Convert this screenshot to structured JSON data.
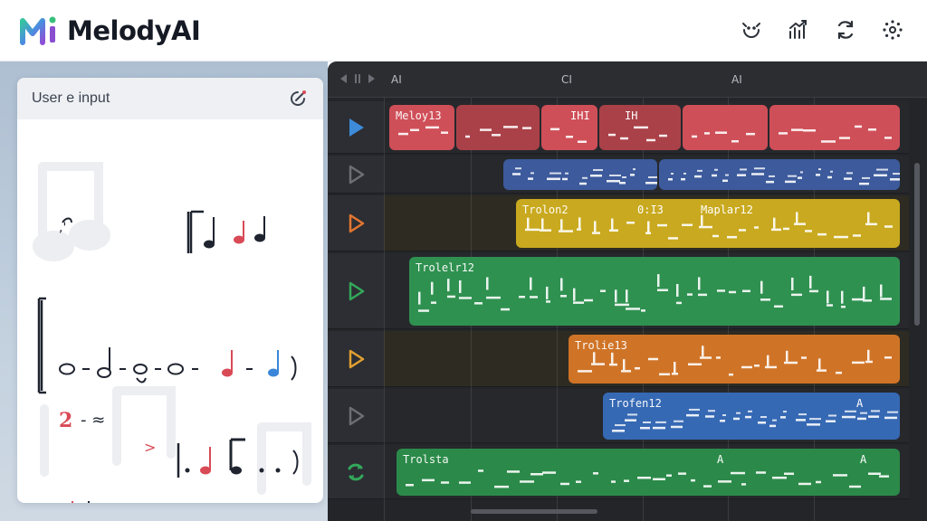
{
  "app": {
    "title": "MelodyAI"
  },
  "header": {
    "actions": [
      {
        "icon": "emoji-smile-icon"
      },
      {
        "icon": "analytics-icon"
      },
      {
        "icon": "refresh-icon"
      },
      {
        "icon": "settings-dots-icon"
      }
    ]
  },
  "input_panel": {
    "title": "User е input",
    "notation_text": {
      "line3_a": "2",
      "line3_b": "- ≈",
      "line4_a": ">",
      "line5_a": "?"
    }
  },
  "daw": {
    "ruler_labels": [
      "AI",
      "CI",
      "AI"
    ],
    "tracks": [
      {
        "button": "play",
        "color": "#3d8bd9"
      },
      {
        "button": "play",
        "color": "#6b6e74"
      },
      {
        "button": "play",
        "color": "#e2752f"
      },
      {
        "button": "play",
        "color": "#33a85a"
      },
      {
        "button": "play",
        "color": "#e0a030"
      },
      {
        "button": "play",
        "color": "#6b6e74"
      },
      {
        "button": "loop",
        "color": "#33a85a"
      }
    ],
    "clips": [
      {
        "label": "Meloy13",
        "marks": [
          "IHI",
          "IH"
        ],
        "color": "#cf4f58"
      },
      {
        "label": "",
        "marks": [],
        "color": "#3c5a9c"
      },
      {
        "label": "Trolon2",
        "marks": [
          "0:I3",
          "Maplar12"
        ],
        "color": "#c9a91f"
      },
      {
        "label": "Trolelr12",
        "marks": [],
        "color": "#2f9150"
      },
      {
        "label": "Trolie13",
        "marks": [],
        "color": "#cf7427"
      },
      {
        "label": "Trofen12",
        "marks": [
          "A"
        ],
        "color": "#3669b4"
      },
      {
        "label": "Trolsta",
        "marks": [
          "A",
          "A"
        ],
        "color": "#2b8a49"
      }
    ]
  },
  "colors": {
    "accent_red": "#d84a56",
    "accent_blue": "#3a86d8",
    "logo_green": "#38c07a",
    "logo_purple": "#8a4fd1"
  }
}
